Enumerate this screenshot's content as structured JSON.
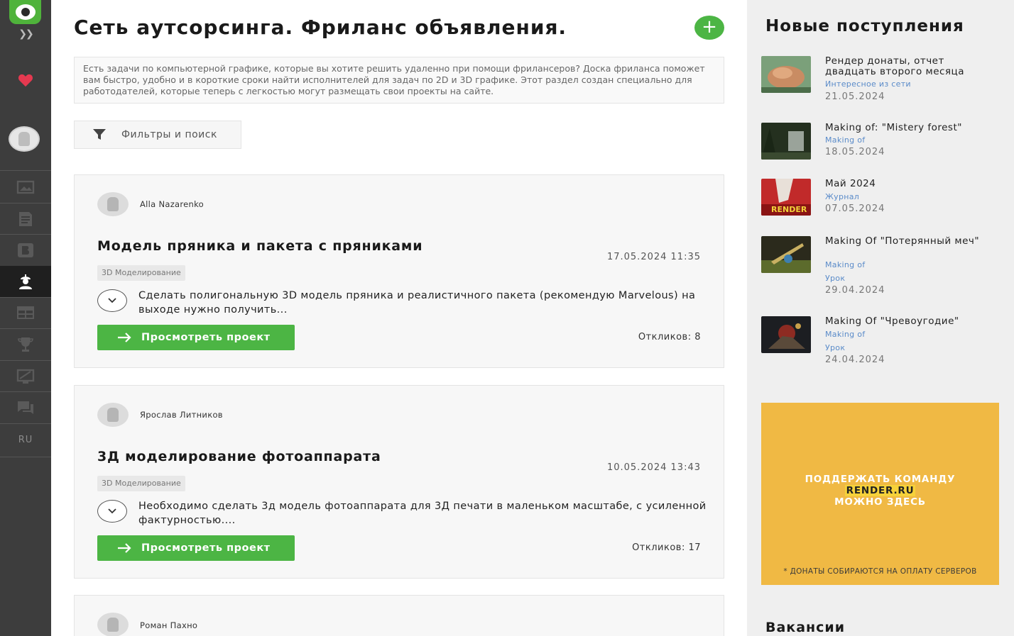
{
  "sidebar": {
    "expand_icon": "double-chevron-right-icon",
    "lang": "RU",
    "colors": {
      "bg": "#3d3d3d",
      "logo": "#4fb33b",
      "heart": "#e53950"
    }
  },
  "main": {
    "title": "Сеть аутсорсинга. Фриланс объявления.",
    "add_label": "+",
    "intro": "Есть задачи по компьютерной графике, которые вы хотите решить удаленно при помощи фрилансеров? Доска фриланса поможет вам быстро, удобно и в короткие сроки найти исполнителей для задач по 2D и 3D графике. Этот раздел создан специально для работодателей, которые теперь с легкостью могут размещать свои проекты на сайте.",
    "filter_label": "Фильтры и поиск",
    "cards": [
      {
        "author": "Alla Nazarenko",
        "title": "Модель пряника и пакета с пряниками",
        "date": "17.05.2024 11:35",
        "tag": "3D Моделирование",
        "desc": "Сделать полигональную 3D модель пряника и реалистичного пакета (рекомендую Marvelous) на выходе нужно получить...",
        "button": "Просмотреть проект",
        "replies": "Откликов: 8"
      },
      {
        "author": "Ярослав Литников",
        "title": "3Д моделирование фотоаппарата",
        "date": "10.05.2024 13:43",
        "tag": "3D Моделирование",
        "desc": "Необходимо сделать 3д модель фотоаппарата для 3Д печати в маленьком масштабе, с усиленной фактурностью....",
        "button": "Просмотреть проект",
        "replies": "Откликов: 17"
      },
      {
        "author": "Роман Пахно"
      }
    ],
    "colors": {
      "accent": "#4cb544"
    }
  },
  "right": {
    "title": "Новые поступления",
    "news": [
      {
        "title": "Рендер донаты, отчет двадцать второго месяца",
        "cats": [
          "Интересное из сети"
        ],
        "date": "21.05.2024"
      },
      {
        "title": "Making of: \"Mistery forest\"",
        "cats": [
          "Making of"
        ],
        "date": "18.05.2024"
      },
      {
        "title": "Май 2024",
        "cats": [
          "Журнал"
        ],
        "date": "07.05.2024"
      },
      {
        "title": "Making Of \"Потерянный меч\"",
        "cats": [
          "Making of",
          "Урок"
        ],
        "date": "29.04.2024"
      },
      {
        "title": "Making Of \"Чревоугодие\"",
        "cats": [
          "Making of",
          "Урок"
        ],
        "date": "24.04.2024"
      }
    ],
    "banner": {
      "line1": "ПОДДЕРЖАТЬ КОМАНДУ",
      "line2": "RENDER.RU",
      "line3": "МОЖНО ЗДЕСЬ",
      "footnote": "* ДОНАТЫ СОБИРАЮТСЯ НА ОПЛАТУ СЕРВЕРОВ",
      "thumb_logo": "RENDER"
    },
    "vacancies": "Вакансии"
  }
}
